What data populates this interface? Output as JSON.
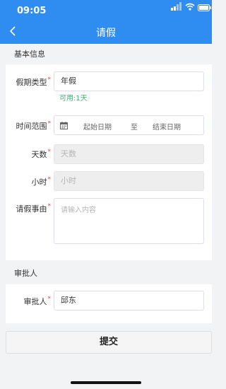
{
  "status_bar": {
    "time": "09:05"
  },
  "nav": {
    "title": "请假"
  },
  "basic_section": {
    "title": "基本信息"
  },
  "fields": {
    "leave_type": {
      "label": "假期类型",
      "value": "年假",
      "hint": "可用:1天"
    },
    "time_range": {
      "label": "时间范围",
      "start_placeholder": "起始日期",
      "separator": "至",
      "end_placeholder": "结束日期"
    },
    "days": {
      "label": "天数",
      "placeholder": "天数"
    },
    "hours": {
      "label": "小时",
      "placeholder": "小时"
    },
    "reason": {
      "label": "请假事由",
      "placeholder": "请输入内容"
    }
  },
  "approver_section": {
    "title": "审批人"
  },
  "approver": {
    "label": "审批人",
    "value": "邱东"
  },
  "required_mark": "*",
  "submit": {
    "label": "提交"
  },
  "colors": {
    "header": "#2f8cf0",
    "hint": "#3cb371",
    "required": "#e64340"
  },
  "icons": [
    "chevron-left-icon",
    "calendar-icon",
    "signal-icon",
    "wifi-icon",
    "battery-icon"
  ]
}
